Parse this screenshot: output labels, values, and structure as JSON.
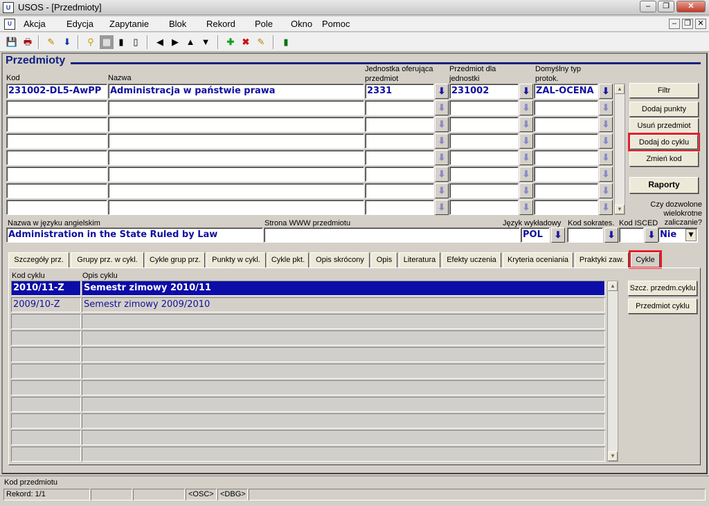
{
  "window": {
    "app_icon_text": "USOS",
    "title": "USOS - [Przedmioty]"
  },
  "menu": [
    "Akcja",
    "Edycja",
    "Zapytanie",
    "Blok",
    "Rekord",
    "Pole",
    "Okno",
    "Pomoc"
  ],
  "block": {
    "title": "Przedmioty",
    "labels": {
      "kod": "Kod",
      "nazwa": "Nazwa",
      "jednostka": "Jednostka oferująca przedmiot",
      "przedmiot_dla": "Przedmiot dla jednostki",
      "domyslny": "Domyślny typ protok.",
      "nazwa_ang": "Nazwa w języku angielskim",
      "strona": "Strona WWW  przedmiotu",
      "jezyk": "Język wykładowy",
      "sokrates": "Kod sokrates.",
      "isced": "Kod ISCED",
      "wielokrotne": "Czy dozwolone wielokrotne zaliczanie?"
    },
    "record": {
      "kod": "231002-DL5-AwPP",
      "nazwa": "Administracja w państwie prawa",
      "jednostka": "2331",
      "przedmiot_dla": "231002",
      "domyslny": "ZAL-OCENA",
      "nazwa_ang": "Administration in the State Ruled by Law",
      "strona": "",
      "jezyk": "POL",
      "sokrates": "",
      "isced": "",
      "wielokrotne": "Nie"
    },
    "empty_rows": 7
  },
  "buttons": {
    "filtr": "Filtr",
    "dodaj_punkty": "Dodaj punkty",
    "usun": "Usuń przedmiot",
    "dodaj_do_cyklu": "Dodaj do cyklu",
    "zmien_kod": "Zmień kod",
    "raporty": "Raporty"
  },
  "tabs": [
    "Szczegóły prz.",
    "Grupy prz. w cykl.",
    "Cykle grup prz.",
    "Punkty w cykl.",
    "Cykle pkt.",
    "Opis skrócony",
    "Opis",
    "Literatura",
    "Efekty uczenia",
    "Kryteria oceniania",
    "Praktyki zaw.",
    "Cykle"
  ],
  "active_tab": "Cykle",
  "cycles": {
    "labels": {
      "kod": "Kod cyklu",
      "opis": "Opis cyklu"
    },
    "rows": [
      {
        "kod": "2010/11-Z",
        "opis": "Semestr zimowy 2010/11"
      },
      {
        "kod": "2009/10-Z",
        "opis": "Semestr zimowy 2009/2010"
      }
    ],
    "empty_rows": 9,
    "buttons": {
      "szczegoly": "Szcz. przedm.cyklu",
      "przedmiot": "Przedmiot cyklu"
    }
  },
  "status": {
    "hint": "Kod przedmiotu",
    "record": "Rekord: 1/1",
    "osc": "<OSC>",
    "dbg": "<DBG>"
  }
}
